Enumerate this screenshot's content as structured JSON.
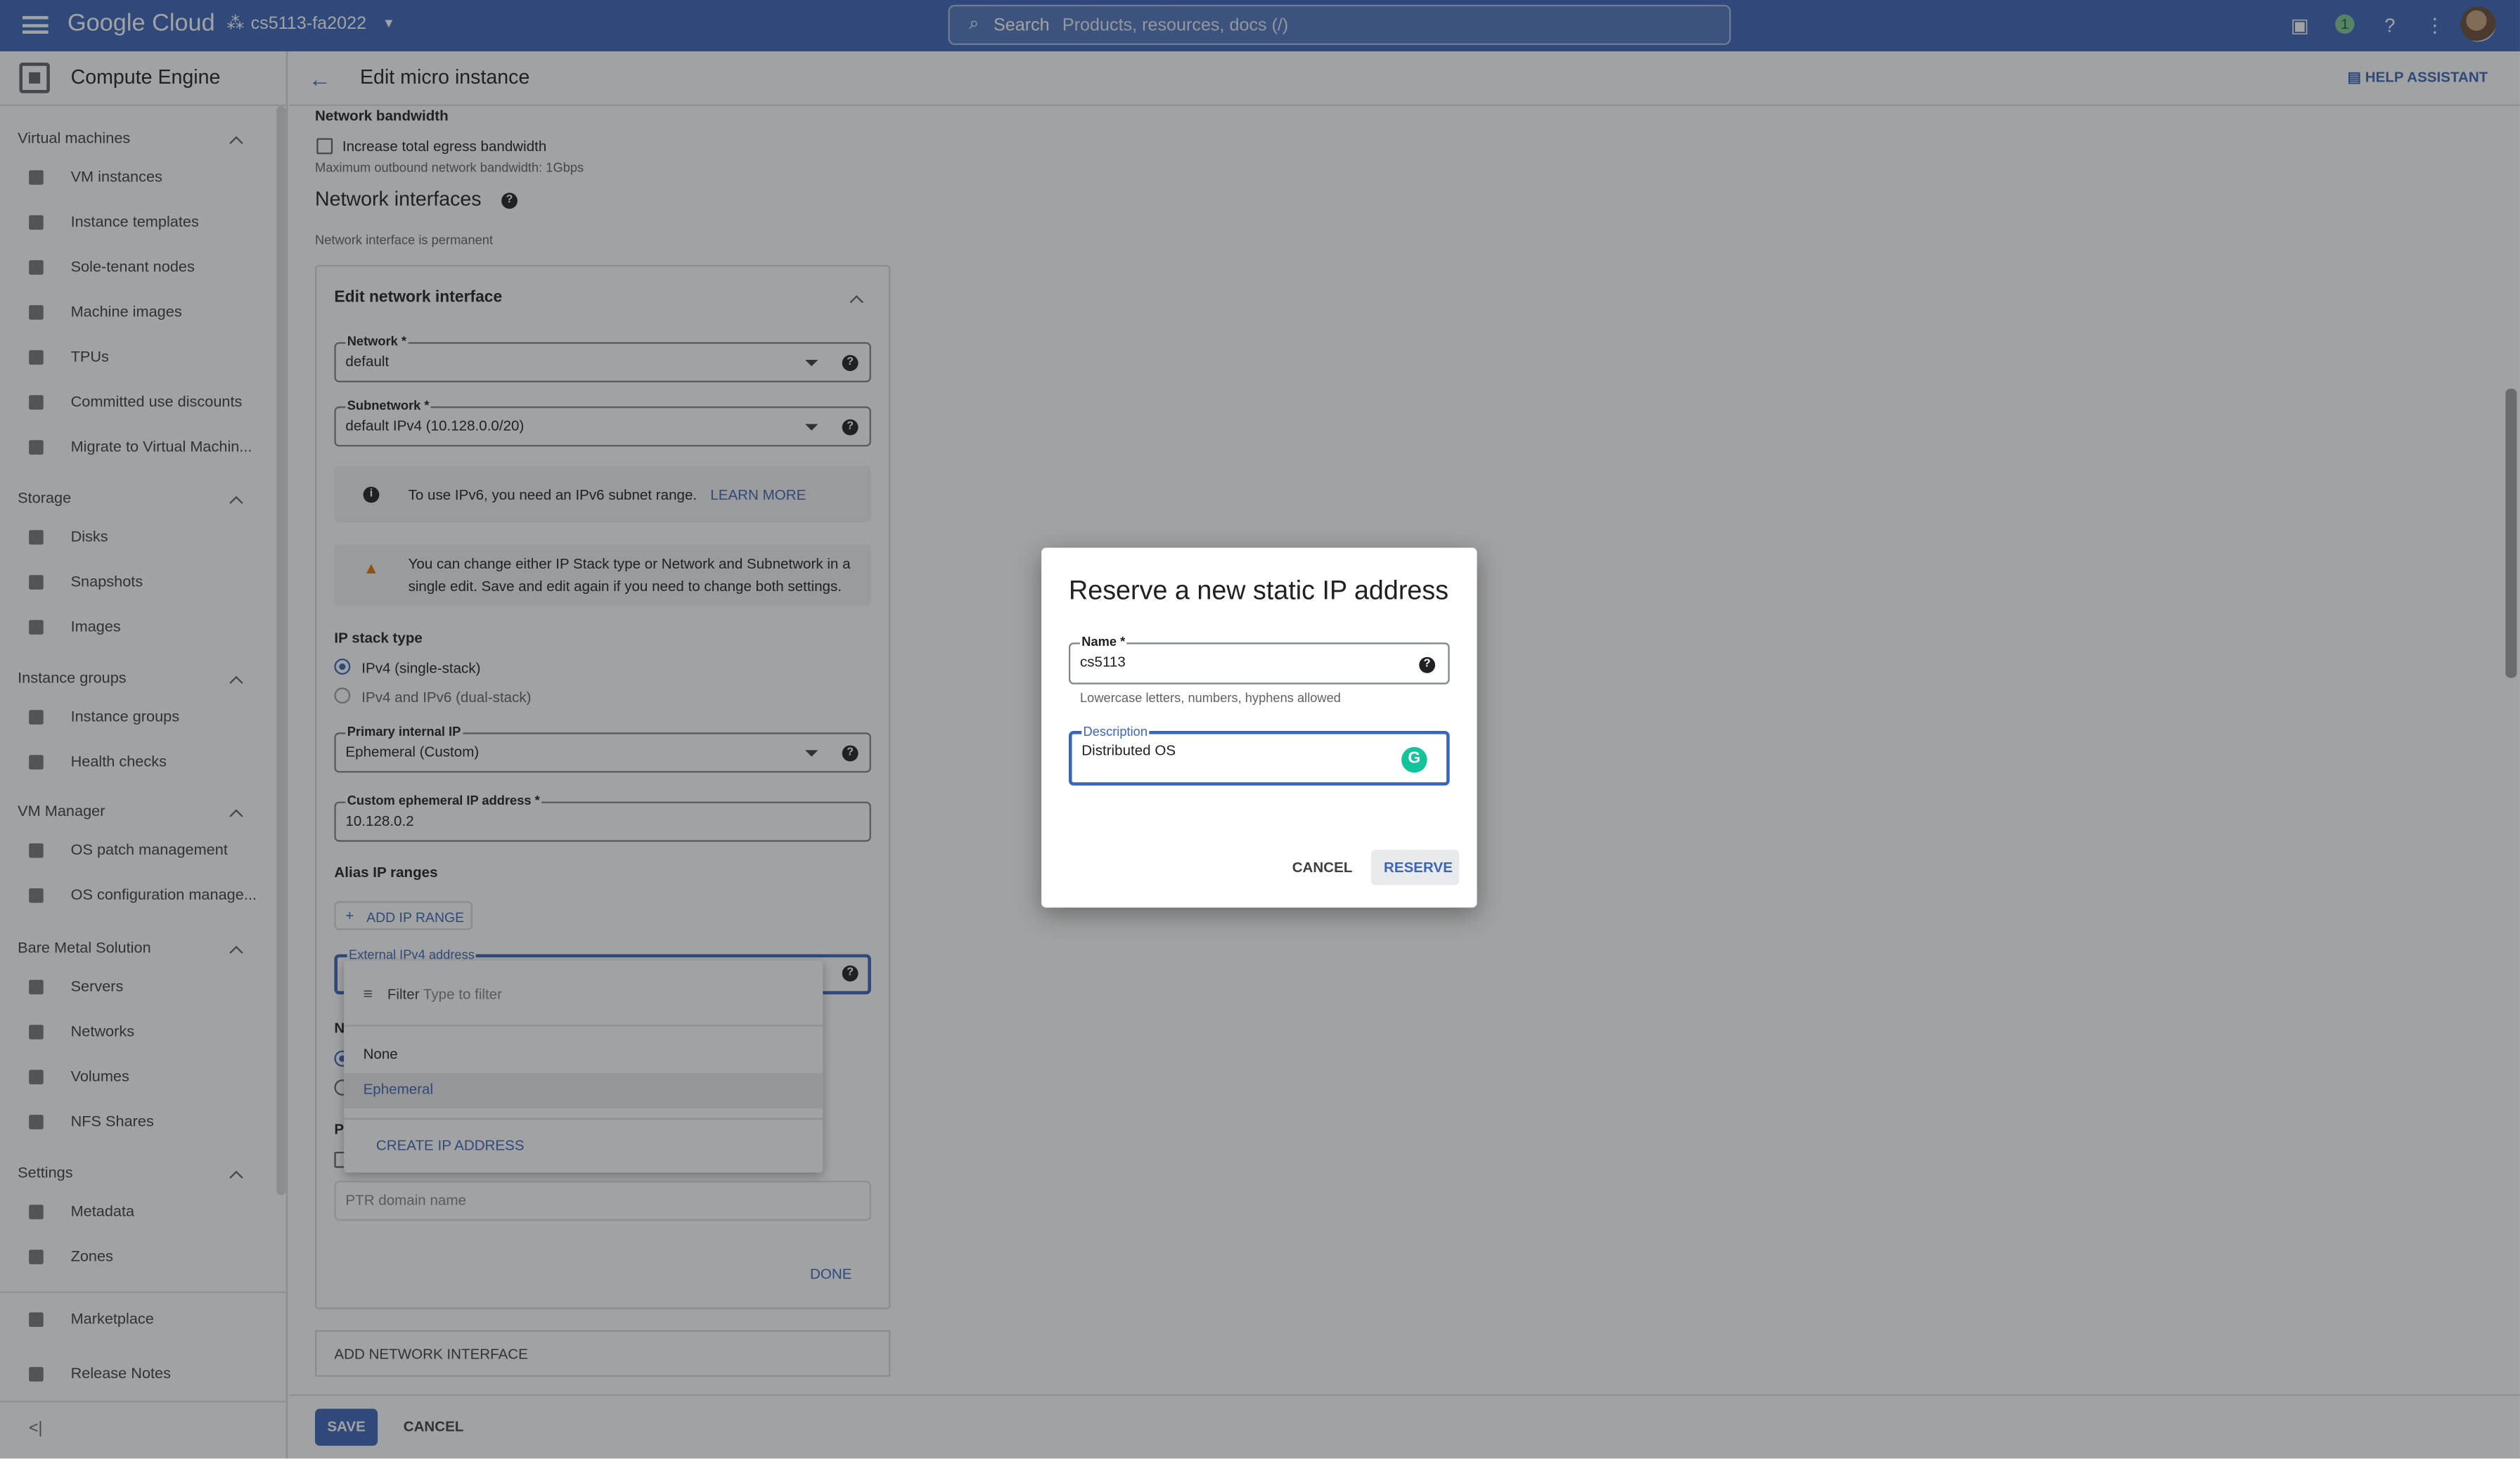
{
  "topbar": {
    "logo_google": "Google",
    "logo_cloud": "Cloud",
    "project": "cs5113-fa2022",
    "search_label": "Search",
    "search_placeholder": "Products, resources, docs (/)",
    "notification_count": "1"
  },
  "sidebar": {
    "title": "Compute Engine",
    "sections": [
      {
        "label": "Virtual machines",
        "items": [
          "VM instances",
          "Instance templates",
          "Sole-tenant nodes",
          "Machine images",
          "TPUs",
          "Committed use discounts",
          "Migrate to Virtual Machin..."
        ]
      },
      {
        "label": "Storage",
        "items": [
          "Disks",
          "Snapshots",
          "Images"
        ]
      },
      {
        "label": "Instance groups",
        "items": [
          "Instance groups",
          "Health checks"
        ]
      },
      {
        "label": "VM Manager",
        "items": [
          "OS patch management",
          "OS configuration manage..."
        ]
      },
      {
        "label": "Bare Metal Solution",
        "items": [
          "Servers",
          "Networks",
          "Volumes",
          "NFS Shares"
        ]
      },
      {
        "label": "Settings",
        "items": [
          "Metadata",
          "Zones"
        ]
      }
    ],
    "footer_items": [
      "Marketplace",
      "Release Notes"
    ]
  },
  "header": {
    "title": "Edit micro instance",
    "help_assistant": "HELP ASSISTANT"
  },
  "form": {
    "bandwidth_title": "Network bandwidth",
    "egress_label": "Increase total egress bandwidth",
    "egress_hint": "Maximum outbound network bandwidth: 1Gbps",
    "interfaces_title": "Network interfaces",
    "interfaces_hint": "Network interface is permanent",
    "edit_title": "Edit network interface",
    "network": {
      "label": "Network *",
      "value": "default"
    },
    "subnetwork": {
      "label": "Subnetwork *",
      "value": "default IPv4 (10.128.0.0/20)"
    },
    "ipv6_info": "To use IPv6, you need an IPv6 subnet range.",
    "learn_more": "LEARN MORE",
    "warning_line1": "You can change either IP Stack type or Network and Subnetwork in a",
    "warning_line2": "single edit. Save and edit again if you need to change both settings.",
    "ip_stack_title": "IP stack type",
    "ip_stack_options": [
      "IPv4 (single-stack)",
      "IPv4 and IPv6 (dual-stack)"
    ],
    "primary_ip": {
      "label": "Primary internal IP",
      "value": "Ephemeral (Custom)"
    },
    "custom_ip": {
      "label": "Custom ephemeral IP address *",
      "value": "10.128.0.2"
    },
    "alias_title": "Alias IP ranges",
    "add_ip_range": "ADD IP RANGE",
    "external_ip": {
      "label": "External IPv4 address"
    },
    "hidden_n": "N",
    "hidden_pr": "Pr",
    "ptr_placeholder": "PTR domain name",
    "done": "DONE",
    "add_interface": "ADD NETWORK INTERFACE",
    "save": "SAVE",
    "cancel": "CANCEL"
  },
  "dropdown": {
    "filter_label": "Filter",
    "filter_placeholder": "Type to filter",
    "options": [
      "None",
      "Ephemeral"
    ],
    "create": "CREATE IP ADDRESS"
  },
  "dialog": {
    "title": "Reserve a new static IP address",
    "name_label": "Name *",
    "name_value": "cs5113",
    "name_hint": "Lowercase letters, numbers, hyphens allowed",
    "desc_label": "Description",
    "desc_value": "Distributed OS",
    "cancel": "CANCEL",
    "reserve": "RESERVE"
  },
  "colors": {
    "brand": "#3b66b8",
    "topbar": "#3b66b8",
    "grammarly": "#15c39a"
  }
}
